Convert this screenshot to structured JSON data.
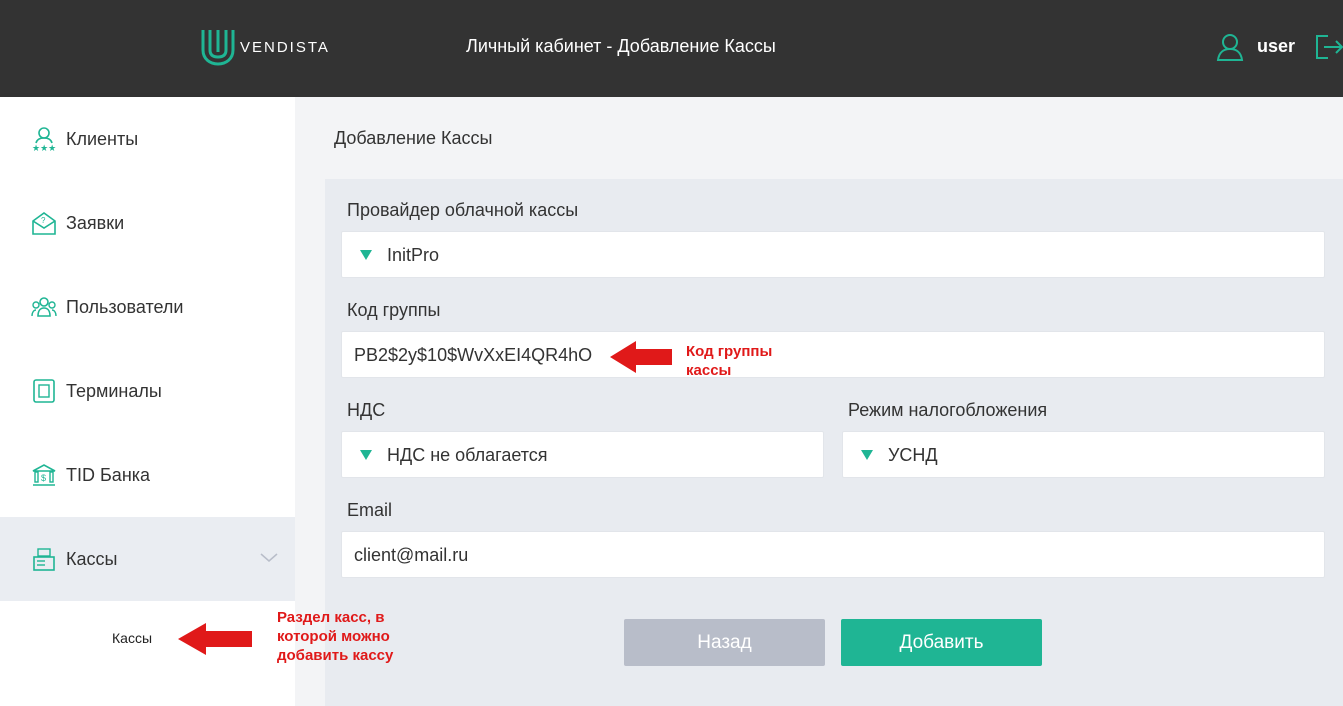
{
  "header": {
    "logo_text": "VENDISTA",
    "title": "Личный кабинет - Добавление Кассы",
    "user": "user",
    "accent_color": "#1fb594"
  },
  "sidebar": {
    "items": [
      {
        "label": "Клиенты",
        "icon": "clients-icon"
      },
      {
        "label": "Заявки",
        "icon": "requests-icon"
      },
      {
        "label": "Пользователи",
        "icon": "users-icon"
      },
      {
        "label": "Терминалы",
        "icon": "terminal-icon"
      },
      {
        "label": "TID Банка",
        "icon": "bank-icon"
      },
      {
        "label": "Кассы",
        "icon": "cash-register-icon"
      }
    ],
    "sub_item": "Кассы"
  },
  "main": {
    "page_title": "Добавление Кассы",
    "provider_label": "Провайдер облачной кассы",
    "provider_value": "InitPro",
    "group_code_label": "Код группы",
    "group_code_value": "PB2$2y$10$WvXxEI4QR4hO",
    "vat_label": "НДС",
    "vat_value": "НДС не облагается",
    "tax_label": "Режим налогобложения",
    "tax_value": "УСНД",
    "email_label": "Email",
    "email_value": "client@mail.ru",
    "back_button": "Назад",
    "add_button": "Добавить"
  },
  "annotations": {
    "group_code_line1": "Код группы",
    "group_code_line2": "кассы",
    "section_line1": "Раздел касс, в",
    "section_line2": "которой можно",
    "section_line3": "добавить кассу",
    "color": "#e01919"
  }
}
